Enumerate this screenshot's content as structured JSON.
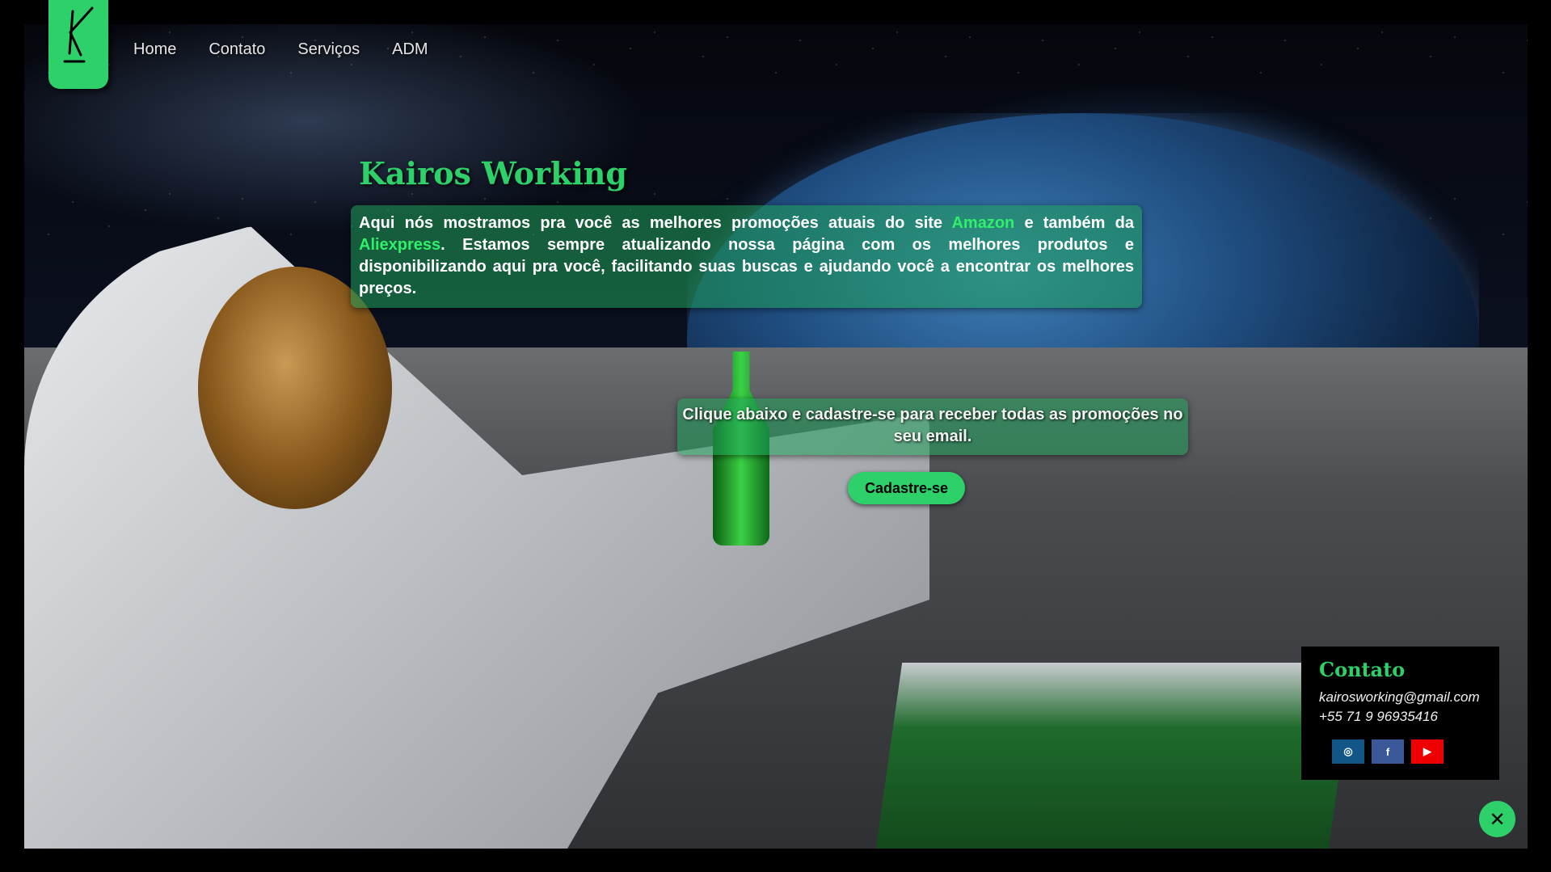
{
  "nav": {
    "items": [
      {
        "label": "Home"
      },
      {
        "label": "Contato"
      },
      {
        "label": "Serviços"
      },
      {
        "label": "ADM"
      }
    ]
  },
  "hero": {
    "title": "Kairos Working",
    "p1": "Aqui nós mostramos pra você as melhores promoções atuais do site ",
    "amazon": "Amazon",
    "p2": " e também da ",
    "aliexpress": "Aliexpress",
    "p3": ". Estamos sempre atualizando nossa página com os melhores produtos e disponibilizando aqui pra você, facilitando suas buscas e ajudando você a encontrar os melhores preços."
  },
  "promo": {
    "text": "Clique abaixo e cadastre-se para receber todas as promoções no seu email.",
    "button_label": "Cadastre-se"
  },
  "contact": {
    "title": "Contato",
    "email": "kairosworking@gmail.com",
    "phone": "+55 71 9 96935416",
    "social": [
      {
        "icon": "instagram-icon",
        "glyph": "◎"
      },
      {
        "icon": "facebook-icon",
        "glyph": "f"
      },
      {
        "icon": "youtube-icon",
        "glyph": "▶"
      }
    ]
  },
  "close_glyph": "✕",
  "colors": {
    "accent": "#2ed06a",
    "highlight": "#2ef06a",
    "instagram": "#125688",
    "facebook": "#3b5998",
    "youtube": "#ee0000"
  }
}
